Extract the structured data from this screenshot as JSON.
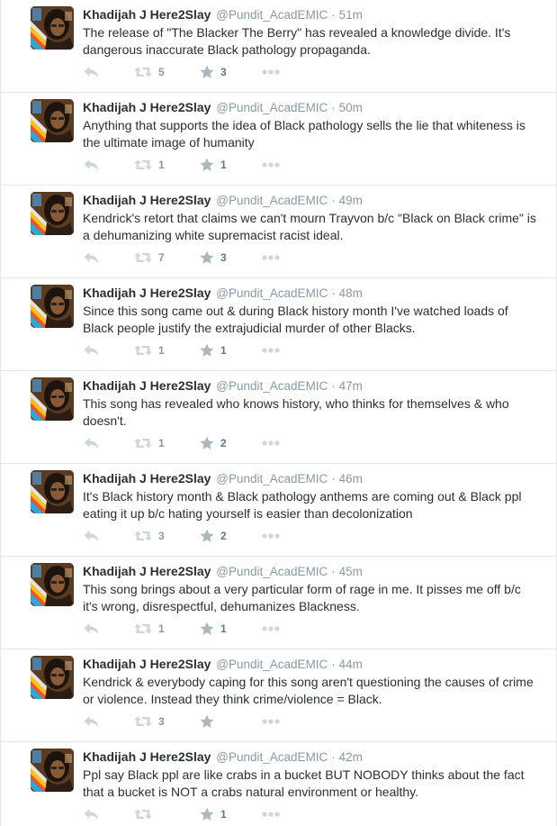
{
  "colors": {
    "text": "#292f33",
    "secondary": "#8899a6",
    "icon": "#ccd6dd",
    "star": "#aab8c2",
    "border": "#e1e8ed"
  },
  "tweets": [
    {
      "name": "Khadijah J Here2Slay",
      "handle": "@Pundit_AcadEMIC",
      "dot": "·",
      "time": "51m",
      "text": "The release of \"The Blacker The Berry\" has revealed a knowledge divide. It's dangerous inaccurate Black pathology propaganda.",
      "retweets": "5",
      "favorites": "3"
    },
    {
      "name": "Khadijah J Here2Slay",
      "handle": "@Pundit_AcadEMIC",
      "dot": "·",
      "time": "50m",
      "text": "Anything that supports the idea of Black pathology sells the lie that whiteness is the ultimate image of humanity",
      "retweets": "1",
      "favorites": "1"
    },
    {
      "name": "Khadijah J Here2Slay",
      "handle": "@Pundit_AcadEMIC",
      "dot": "·",
      "time": "49m",
      "text": "Kendrick's retort that claims we can't mourn Trayvon b/c \"Black on Black crime\" is a dehumanizing white supremacist racist ideal.",
      "retweets": "7",
      "favorites": "3"
    },
    {
      "name": "Khadijah J Here2Slay",
      "handle": "@Pundit_AcadEMIC",
      "dot": "·",
      "time": "48m",
      "text": "Since this song came out & during Black history month I've watched loads of Black people justify the extrajudicial murder of other Blacks.",
      "retweets": "1",
      "favorites": "1"
    },
    {
      "name": "Khadijah J Here2Slay",
      "handle": "@Pundit_AcadEMIC",
      "dot": "·",
      "time": "47m",
      "text": "This song has revealed who knows history, who thinks for themselves & who doesn't.",
      "retweets": "1",
      "favorites": "2"
    },
    {
      "name": "Khadijah J Here2Slay",
      "handle": "@Pundit_AcadEMIC",
      "dot": "·",
      "time": "46m",
      "text": "It's Black history month & Black pathology anthems are coming out & Black ppl eating it up b/c hating yourself is easier than decolonization",
      "retweets": "3",
      "favorites": "2"
    },
    {
      "name": "Khadijah J Here2Slay",
      "handle": "@Pundit_AcadEMIC",
      "dot": "·",
      "time": "45m",
      "text": "This song brings about a very particular form of rage in me. It pisses me off b/c it's wrong, disrespectful, dehumanizes Blackness.",
      "retweets": "1",
      "favorites": "1"
    },
    {
      "name": "Khadijah J Here2Slay",
      "handle": "@Pundit_AcadEMIC",
      "dot": "·",
      "time": "44m",
      "text": "Kendrick & everybody caping for this song aren't questioning the causes of crime or violence. Instead they think crime/violence = Black.",
      "retweets": "3",
      "favorites": ""
    },
    {
      "name": "Khadijah J Here2Slay",
      "handle": "@Pundit_AcadEMIC",
      "dot": "·",
      "time": "42m",
      "text": "Ppl say Black ppl are like crabs in a bucket BUT NOBODY thinks about the fact that a bucket is NOT a crabs natural environment or healthy.",
      "retweets": "",
      "favorites": "1"
    }
  ]
}
